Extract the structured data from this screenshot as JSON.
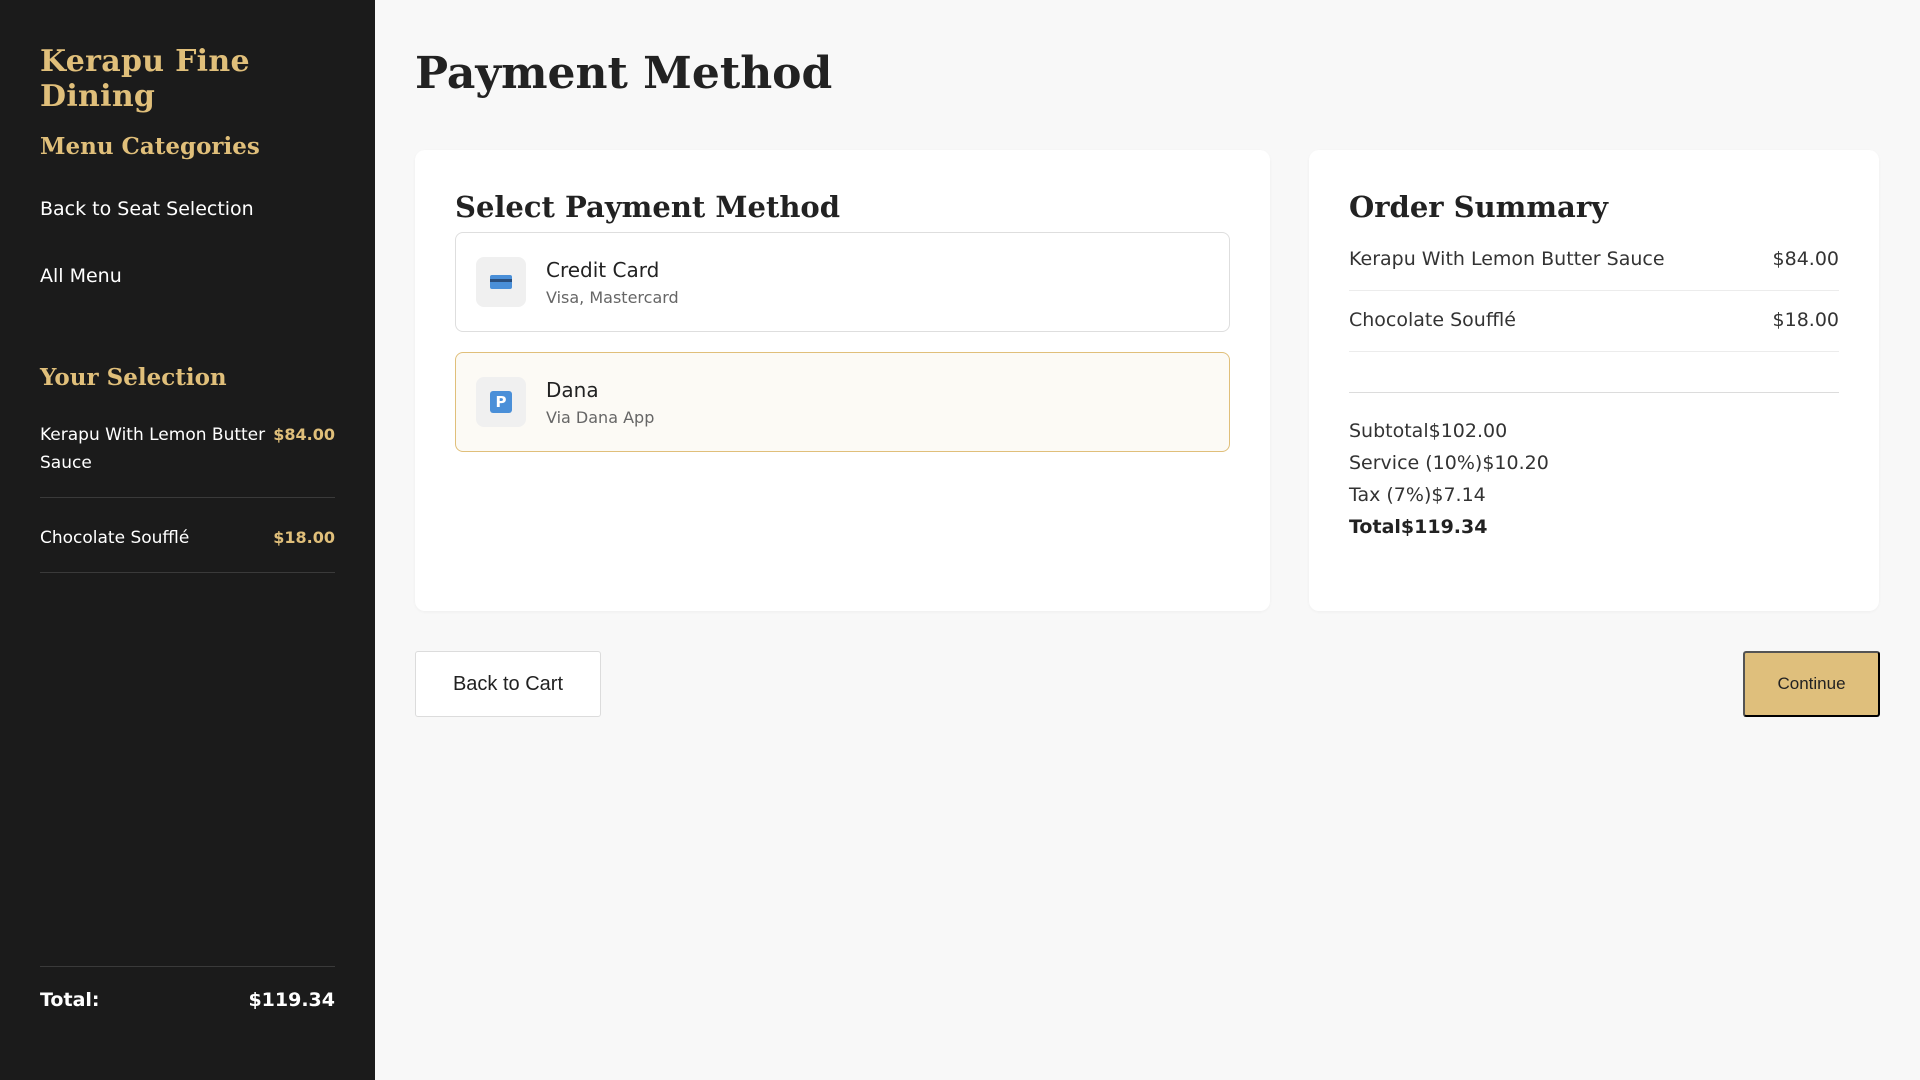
{
  "sidebar": {
    "brand": "Kerapu Fine Dining",
    "categories_heading": "Menu Categories",
    "links": [
      "Back to Seat Selection",
      "All Menu"
    ],
    "selection_heading": "Your Selection",
    "selection": [
      {
        "name": "Kerapu With Lemon Butter Sauce",
        "price": "$84.00"
      },
      {
        "name": "Chocolate Soufflé",
        "price": "$18.00"
      }
    ],
    "total_label": "Total:",
    "total_value": "$119.34"
  },
  "main": {
    "title": "Payment Method",
    "payment": {
      "heading": "Select Payment Method",
      "options": [
        {
          "name": "Credit Card",
          "sub": "Visa, Mastercard",
          "icon": "credit-card-icon",
          "selected": false
        },
        {
          "name": "Dana",
          "sub": "Via Dana App",
          "icon": "parking-p-icon",
          "selected": true
        }
      ]
    },
    "summary": {
      "heading": "Order Summary",
      "items": [
        {
          "name": "Kerapu With Lemon Butter Sauce",
          "price": "$84.00"
        },
        {
          "name": "Chocolate Soufflé",
          "price": "$18.00"
        }
      ],
      "subtotal": "Subtotal$102.00",
      "service": "Service (10%)$10.20",
      "tax": "Tax (7%)$7.14",
      "total": "Total$119.34"
    },
    "back_button": "Back to Cart",
    "continue_button": "Continue"
  },
  "colors": {
    "accent": "#e0bf7a",
    "sidebar_bg": "#1b1b1b",
    "continue_bg": "#dfbf7c"
  }
}
